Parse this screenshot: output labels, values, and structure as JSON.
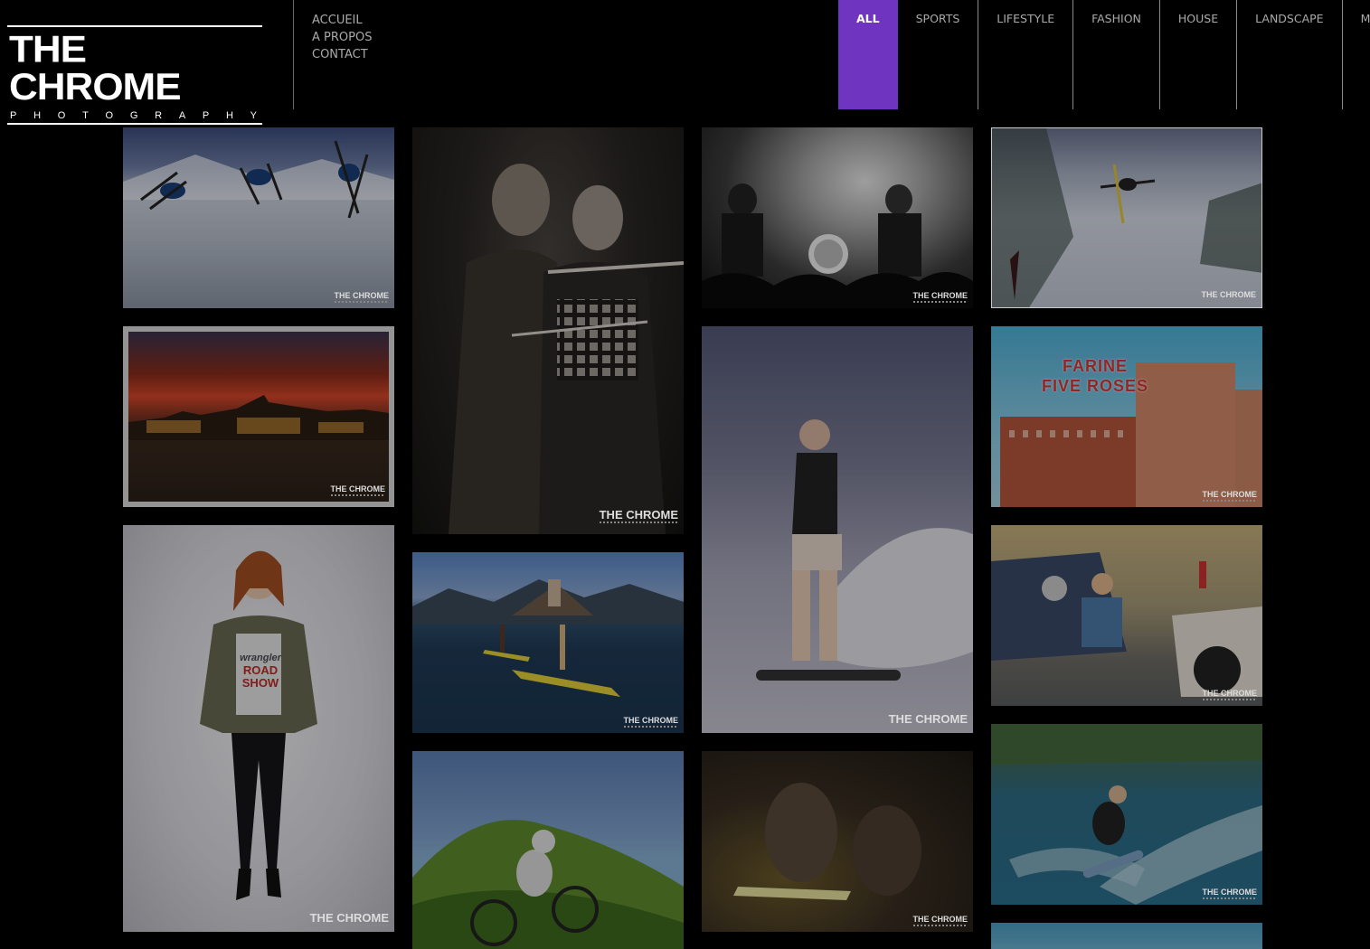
{
  "brand": {
    "title": "THE CHROME",
    "subtitle_letters": [
      "P",
      "H",
      "O",
      "T",
      "O",
      "G",
      "R",
      "A",
      "P",
      "H",
      "Y"
    ]
  },
  "main_nav": [
    "ACCUEIL",
    "A PROPOS",
    "CONTACT"
  ],
  "categories": [
    "ALL",
    "SPORTS",
    "LIFESTYLE",
    "FASHION",
    "HOUSE",
    "LANDSCAPE",
    "MU"
  ],
  "active_category": "ALL",
  "accent_color": "#6f35c0",
  "watermark": "THE CHROME",
  "gallery": [
    {
      "name": "photo-ski-sequence",
      "watermark": "THE CHROME"
    },
    {
      "name": "photo-couple-portrait",
      "watermark": "THE CHROME"
    },
    {
      "name": "photo-concert",
      "watermark": "THE CHROME"
    },
    {
      "name": "photo-ski-jump",
      "watermark": "THE CHROME"
    },
    {
      "name": "photo-sunset-city",
      "watermark": "THE CHROME"
    },
    {
      "name": "photo-wakeboard-girl",
      "watermark": "THE CHROME"
    },
    {
      "name": "photo-farine-five-roses",
      "watermark": "THE CHROME",
      "sign_text": [
        "FARINE",
        "FIVE ROSES"
      ]
    },
    {
      "name": "photo-fashion-model",
      "watermark": "THE CHROME",
      "shirt_text": [
        "wrangler",
        "ROAD",
        "SHOW"
      ]
    },
    {
      "name": "photo-paddleboard-lake",
      "watermark": "THE CHROME"
    },
    {
      "name": "photo-garage-pinup",
      "watermark": "THE CHROME"
    },
    {
      "name": "photo-mountain-bike",
      "watermark": ""
    },
    {
      "name": "photo-knife-portrait",
      "watermark": "THE CHROME"
    },
    {
      "name": "photo-wakeboarder",
      "watermark": "THE CHROME"
    },
    {
      "name": "photo-partial-bottom",
      "watermark": ""
    }
  ]
}
